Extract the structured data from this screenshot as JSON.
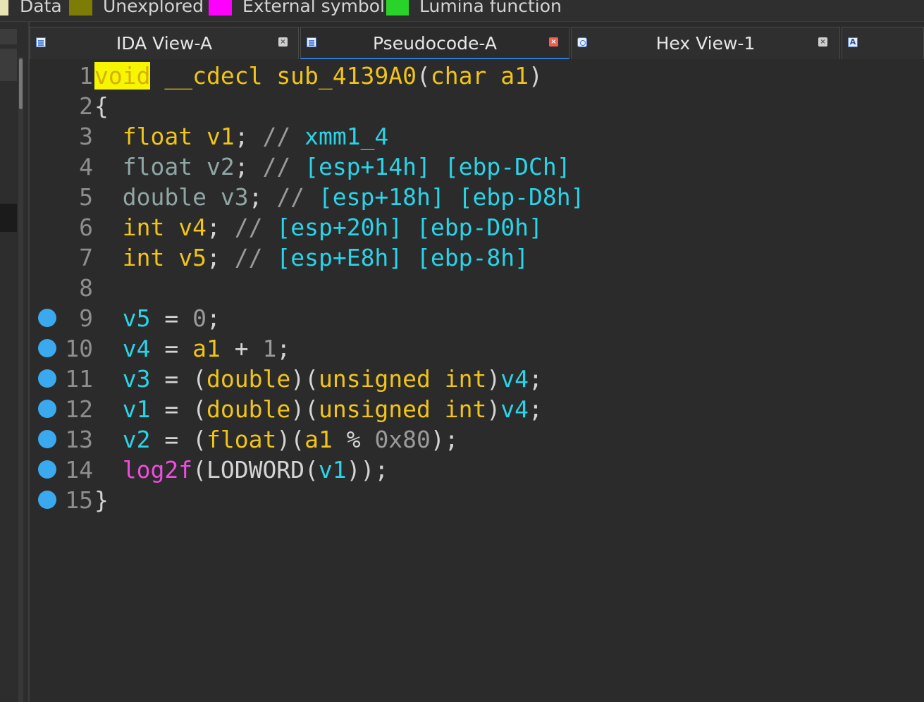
{
  "legend": [
    {
      "label": "Data",
      "color": "#e8e3b4"
    },
    {
      "label": "Unexplored",
      "color": "#7d7d06"
    },
    {
      "label": "External symbol",
      "color": "#ff00ff"
    },
    {
      "label": "Lumina function",
      "color": "#2ad32a"
    }
  ],
  "tabs": [
    {
      "label": "IDA View-A",
      "close": "×",
      "active": false
    },
    {
      "label": "Pseudocode-A",
      "close": "×",
      "active": true
    },
    {
      "label": "Hex View-1",
      "close": "×",
      "active": false
    },
    {
      "label": "",
      "icon": "A",
      "active": false
    }
  ],
  "code": {
    "lines": [
      {
        "num": "1",
        "breakpoint": false,
        "parts": [
          [
            "hl",
            "void"
          ],
          [
            "pl",
            " "
          ],
          [
            "kw",
            "__cdecl"
          ],
          [
            "pl",
            " "
          ],
          [
            "kw",
            "sub_4139A0"
          ],
          [
            "pl",
            "("
          ],
          [
            "kw",
            "char"
          ],
          [
            "pl",
            " "
          ],
          [
            "kw",
            "a1"
          ],
          [
            "pl",
            ")"
          ]
        ]
      },
      {
        "num": "2",
        "breakpoint": false,
        "parts": [
          [
            "pl",
            "{"
          ]
        ]
      },
      {
        "num": "3",
        "breakpoint": false,
        "parts": [
          [
            "pl",
            "  "
          ],
          [
            "kw",
            "float"
          ],
          [
            "pl",
            " "
          ],
          [
            "kw",
            "v1"
          ],
          [
            "pl",
            "; "
          ],
          [
            "num",
            "//"
          ],
          [
            "pl",
            " "
          ],
          [
            "cm",
            "xmm1_4"
          ]
        ]
      },
      {
        "num": "4",
        "breakpoint": false,
        "parts": [
          [
            "pl",
            "  "
          ],
          [
            "kwdim",
            "float v2"
          ],
          [
            "pl",
            "; "
          ],
          [
            "num",
            "//"
          ],
          [
            "pl",
            " "
          ],
          [
            "cm",
            "[esp+14h] [ebp-DCh]"
          ]
        ]
      },
      {
        "num": "5",
        "breakpoint": false,
        "parts": [
          [
            "pl",
            "  "
          ],
          [
            "kwdim",
            "double v3"
          ],
          [
            "pl",
            "; "
          ],
          [
            "num",
            "//"
          ],
          [
            "pl",
            " "
          ],
          [
            "cm",
            "[esp+18h] [ebp-D8h]"
          ]
        ]
      },
      {
        "num": "6",
        "breakpoint": false,
        "parts": [
          [
            "pl",
            "  "
          ],
          [
            "kw",
            "int"
          ],
          [
            "pl",
            " "
          ],
          [
            "kw",
            "v4"
          ],
          [
            "pl",
            "; "
          ],
          [
            "num",
            "//"
          ],
          [
            "pl",
            " "
          ],
          [
            "cm",
            "[esp+20h] [ebp-D0h]"
          ]
        ]
      },
      {
        "num": "7",
        "breakpoint": false,
        "parts": [
          [
            "pl",
            "  "
          ],
          [
            "kw",
            "int"
          ],
          [
            "pl",
            " "
          ],
          [
            "kw",
            "v5"
          ],
          [
            "pl",
            "; "
          ],
          [
            "num",
            "//"
          ],
          [
            "pl",
            " "
          ],
          [
            "cm",
            "[esp+E8h] [ebp-8h]"
          ]
        ]
      },
      {
        "num": "8",
        "breakpoint": false,
        "parts": []
      },
      {
        "num": "9",
        "breakpoint": true,
        "parts": [
          [
            "pl",
            "  "
          ],
          [
            "var",
            "v5"
          ],
          [
            "pl",
            " = "
          ],
          [
            "num",
            "0"
          ],
          [
            "pl",
            ";"
          ]
        ]
      },
      {
        "num": "10",
        "breakpoint": true,
        "parts": [
          [
            "pl",
            "  "
          ],
          [
            "var",
            "v4"
          ],
          [
            "pl",
            " = "
          ],
          [
            "kw",
            "a1"
          ],
          [
            "pl",
            " + "
          ],
          [
            "num",
            "1"
          ],
          [
            "pl",
            ";"
          ]
        ]
      },
      {
        "num": "11",
        "breakpoint": true,
        "parts": [
          [
            "pl",
            "  "
          ],
          [
            "var",
            "v3"
          ],
          [
            "pl",
            " = ("
          ],
          [
            "kw",
            "double"
          ],
          [
            "pl",
            ")("
          ],
          [
            "kw",
            "unsigned int"
          ],
          [
            "pl",
            ")"
          ],
          [
            "var",
            "v4"
          ],
          [
            "pl",
            ";"
          ]
        ]
      },
      {
        "num": "12",
        "breakpoint": true,
        "parts": [
          [
            "pl",
            "  "
          ],
          [
            "var",
            "v1"
          ],
          [
            "pl",
            " = ("
          ],
          [
            "kw",
            "double"
          ],
          [
            "pl",
            ")("
          ],
          [
            "kw",
            "unsigned int"
          ],
          [
            "pl",
            ")"
          ],
          [
            "var",
            "v4"
          ],
          [
            "pl",
            ";"
          ]
        ]
      },
      {
        "num": "13",
        "breakpoint": true,
        "parts": [
          [
            "pl",
            "  "
          ],
          [
            "var",
            "v2"
          ],
          [
            "pl",
            " = ("
          ],
          [
            "kw",
            "float"
          ],
          [
            "pl",
            ")("
          ],
          [
            "kw",
            "a1"
          ],
          [
            "pl",
            " % "
          ],
          [
            "num",
            "0x80"
          ],
          [
            "pl",
            ");"
          ]
        ]
      },
      {
        "num": "14",
        "breakpoint": true,
        "parts": [
          [
            "pl",
            "  "
          ],
          [
            "fn",
            "log2f"
          ],
          [
            "pl",
            "("
          ],
          [
            "pl",
            "LODWORD"
          ],
          [
            "pl",
            "("
          ],
          [
            "var",
            "v1"
          ],
          [
            "pl",
            "));"
          ]
        ]
      },
      {
        "num": "15",
        "breakpoint": true,
        "parts": [
          [
            "pl",
            "}"
          ]
        ]
      }
    ]
  }
}
